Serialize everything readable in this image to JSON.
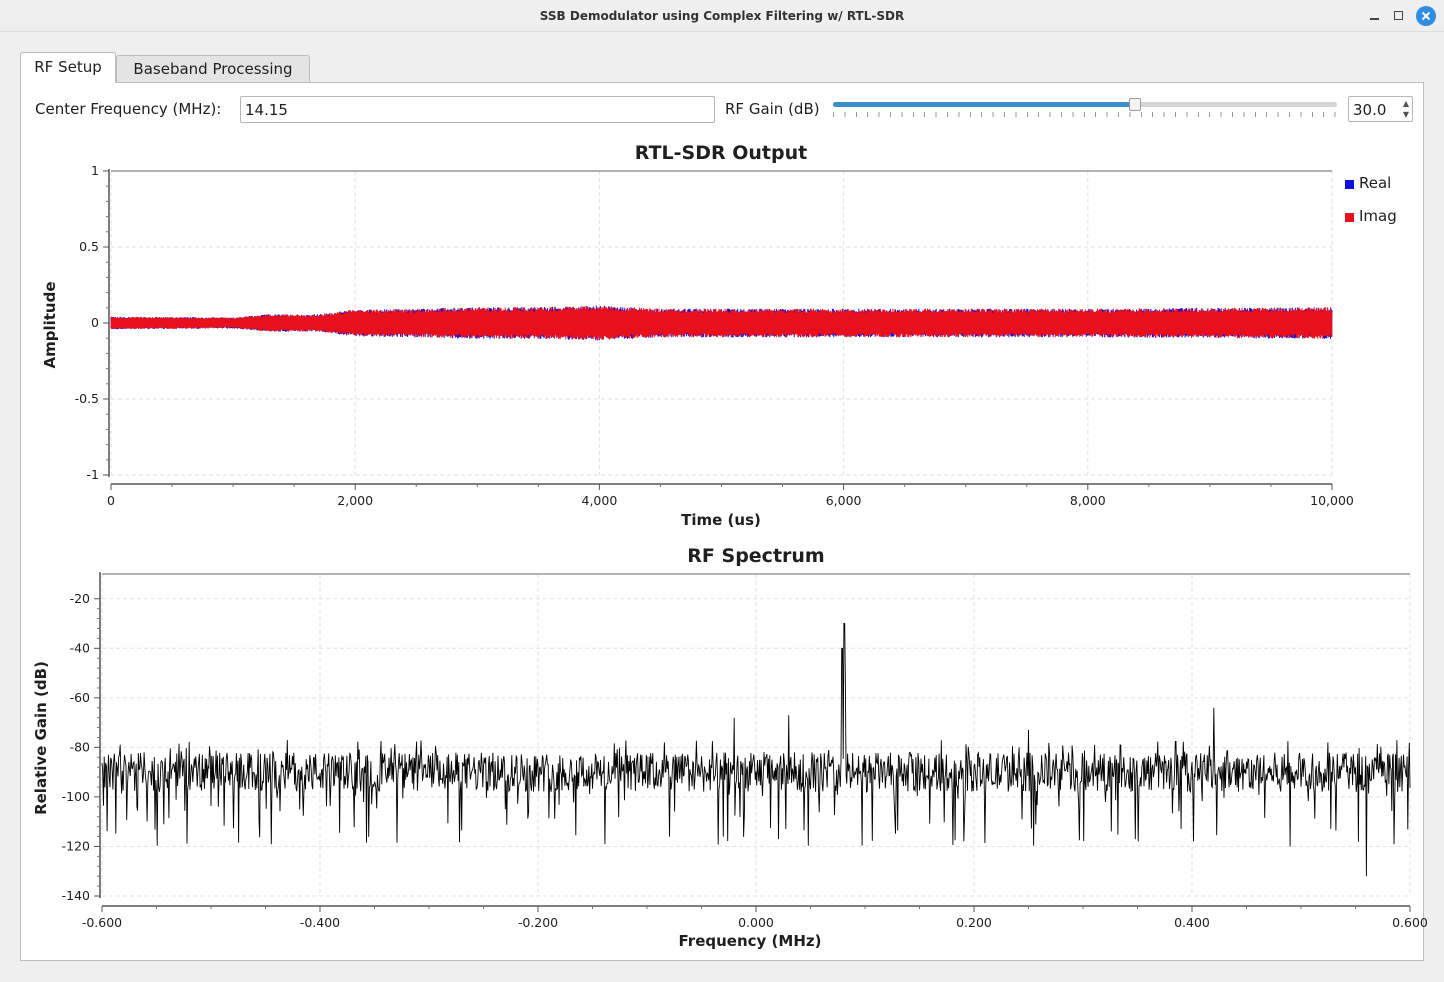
{
  "window": {
    "title": "SSB Demodulator using Complex Filtering w/ RTL-SDR",
    "controls": [
      "minimize-icon",
      "maximize-icon",
      "close-icon"
    ]
  },
  "tabs": [
    {
      "label": "RF Setup",
      "selected": true
    },
    {
      "label": "Baseband Processing",
      "selected": false
    }
  ],
  "controls": {
    "center_freq_label": "Center Frequency (MHz):",
    "center_freq_value": "14.15",
    "rf_gain_label": "RF Gain (dB)",
    "rf_gain_value": "30.0",
    "rf_gain_fraction": 0.6
  },
  "colors": {
    "real": "#1010e0",
    "imag": "#e8101c",
    "spectrum": "#000000",
    "accent": "#3a8fcc"
  },
  "chart_data": [
    {
      "type": "line",
      "title": "RTL-SDR Output",
      "xlabel": "Time (us)",
      "ylabel": "Amplitude",
      "xlim": [
        0,
        10000
      ],
      "ylim": [
        -1,
        1
      ],
      "xticks": [
        0,
        2000,
        4000,
        6000,
        8000,
        10000
      ],
      "xtick_labels": [
        "0",
        "2,000",
        "4,000",
        "6,000",
        "8,000",
        "10,000"
      ],
      "yticks": [
        1,
        0.5,
        0,
        -0.5,
        -1
      ],
      "ytick_labels": [
        "1",
        "0.5",
        "0",
        "-0.5",
        "-1"
      ],
      "grid": true,
      "legend": "right",
      "envelope_x": [
        0,
        1000,
        1300,
        1700,
        2000,
        2500,
        3000,
        3500,
        4000,
        4500,
        5000,
        6000,
        7000,
        8000,
        9000,
        10000
      ],
      "envelope_amp": [
        0.04,
        0.035,
        0.055,
        0.055,
        0.085,
        0.09,
        0.1,
        0.1,
        0.11,
        0.09,
        0.09,
        0.09,
        0.09,
        0.09,
        0.095,
        0.1
      ],
      "series": [
        {
          "name": "Real",
          "color": "#1010e0"
        },
        {
          "name": "Imag",
          "color": "#e8101c"
        }
      ]
    },
    {
      "type": "line",
      "title": "RF Spectrum",
      "xlabel": "Frequency (MHz)",
      "ylabel": "Relative Gain (dB)",
      "xlim": [
        -0.6,
        0.6
      ],
      "ylim": [
        -140,
        -10
      ],
      "xticks": [
        -0.6,
        -0.4,
        -0.2,
        0,
        0.2,
        0.4,
        0.6
      ],
      "xtick_labels": [
        "-0.600",
        "-0.400",
        "-0.200",
        "0.000",
        "0.200",
        "0.400",
        "0.600"
      ],
      "yticks": [
        -20,
        -40,
        -60,
        -80,
        -100,
        -120,
        -140
      ],
      "ytick_labels": [
        "-20",
        "-40",
        "-60",
        "-80",
        "-100",
        "-120",
        "-140"
      ],
      "grid": true,
      "noise_floor_db": -90,
      "peaks": [
        {
          "x": 0.081,
          "y": -30
        },
        {
          "x": 0.079,
          "y": -40
        },
        {
          "x": 0.082,
          "y": -55
        },
        {
          "x": 0.03,
          "y": -67
        },
        {
          "x": -0.02,
          "y": -68
        },
        {
          "x": 0.42,
          "y": -64
        },
        {
          "x": 0.25,
          "y": -73
        },
        {
          "x": -0.43,
          "y": -77
        },
        {
          "x": 0.56,
          "y": -132
        },
        {
          "x": 0.49,
          "y": -120
        },
        {
          "x": -0.03,
          "y": -116
        }
      ]
    }
  ]
}
